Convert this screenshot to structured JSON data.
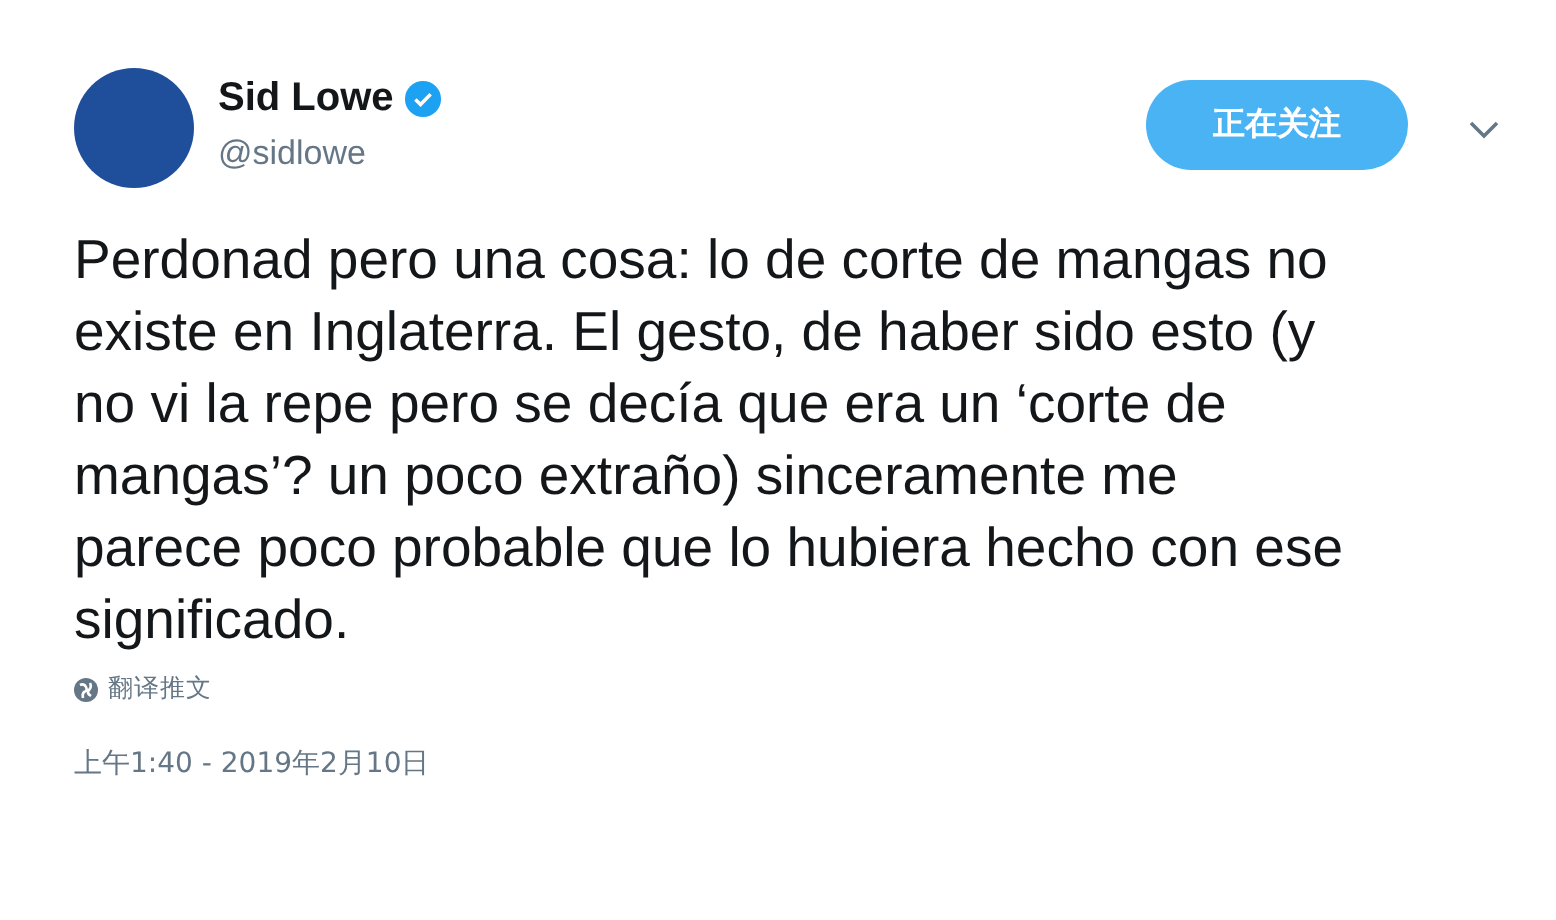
{
  "author": {
    "name": "Sid Lowe",
    "verified": true,
    "handle": "@sidlowe"
  },
  "follow_button": {
    "label": "正在关注"
  },
  "tweet": {
    "text": "Perdonad pero una cosa: lo de corte de mangas no existe en Inglaterra. El gesto, de haber sido esto (y no vi la repe pero se decía que era un ‘corte de mangas’? un poco extraño) sinceramente me parece poco probable que lo hubiera hecho con ese significado."
  },
  "translate_link": {
    "label": "翻译推文"
  },
  "timestamp": "上午1:40 - 2019年2月10日"
}
